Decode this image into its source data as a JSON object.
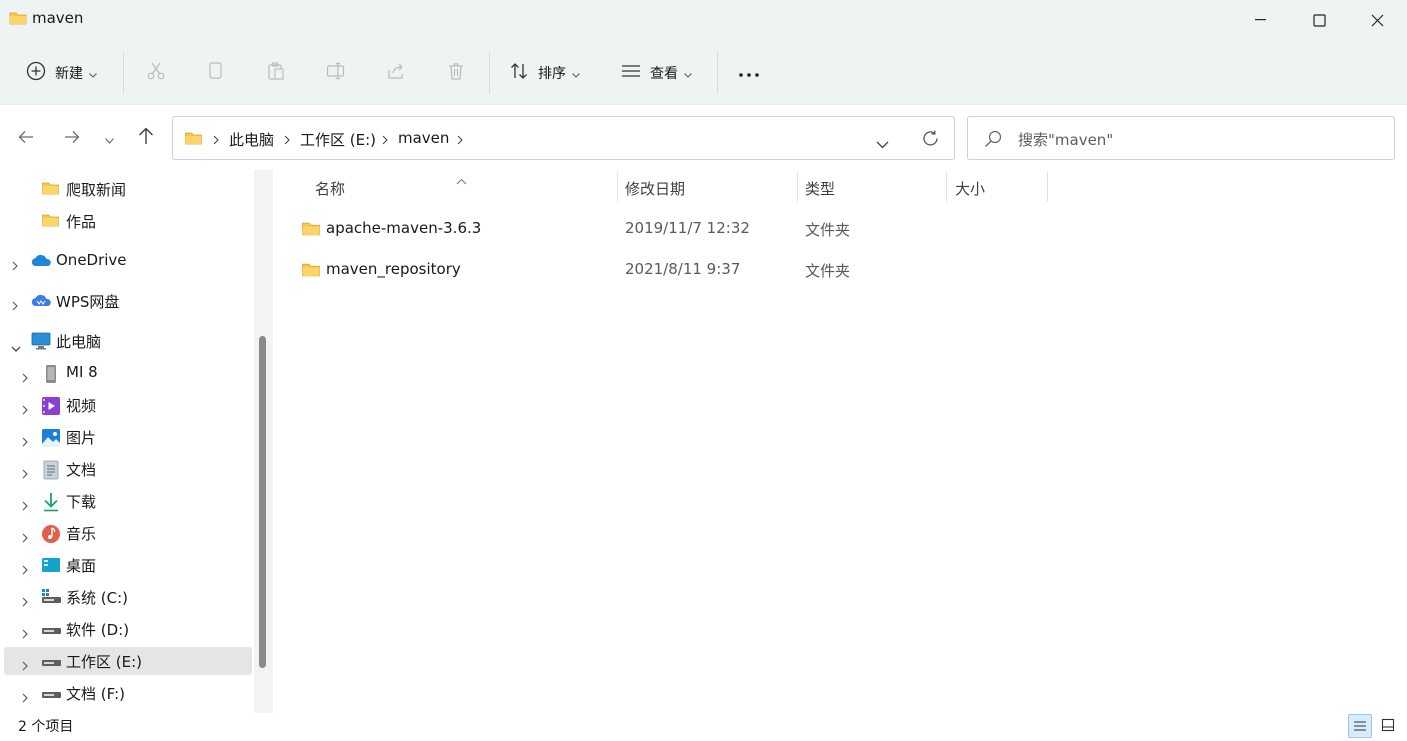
{
  "window": {
    "title": "maven"
  },
  "toolbar": {
    "new_label": "新建",
    "sort_label": "排序",
    "view_label": "查看"
  },
  "address": {
    "crumbs": [
      "此电脑",
      "工作区 (E:)",
      "maven"
    ]
  },
  "search": {
    "placeholder": "搜索\"maven\""
  },
  "sidebar": {
    "items": [
      {
        "label": "爬取新闻",
        "icon": "folder-icon"
      },
      {
        "label": "作品",
        "icon": "folder-icon"
      },
      {
        "label": "OneDrive",
        "icon": "onedrive-cloud-icon"
      },
      {
        "label": "WPS网盘",
        "icon": "wps-cloud-icon"
      },
      {
        "label": "此电脑",
        "icon": "this-pc-icon"
      },
      {
        "label": "MI 8",
        "icon": "phone-icon"
      },
      {
        "label": "视频",
        "icon": "videos-icon"
      },
      {
        "label": "图片",
        "icon": "pictures-icon"
      },
      {
        "label": "文档",
        "icon": "documents-icon"
      },
      {
        "label": "下载",
        "icon": "downloads-icon"
      },
      {
        "label": "音乐",
        "icon": "music-icon"
      },
      {
        "label": "桌面",
        "icon": "desktop-icon"
      },
      {
        "label": "系统 (C:)",
        "icon": "system-drive-icon"
      },
      {
        "label": "软件 (D:)",
        "icon": "drive-icon"
      },
      {
        "label": "工作区 (E:)",
        "icon": "drive-icon"
      },
      {
        "label": "文档 (F:)",
        "icon": "drive-icon"
      }
    ]
  },
  "columns": {
    "name": "名称",
    "date": "修改日期",
    "type": "类型",
    "size": "大小"
  },
  "files": [
    {
      "name": "apache-maven-3.6.3",
      "date": "2019/11/7 12:32",
      "type": "文件夹",
      "size": ""
    },
    {
      "name": "maven_repository",
      "date": "2021/8/11 9:37",
      "type": "文件夹",
      "size": ""
    }
  ],
  "status": {
    "count_text": "2 个项目"
  },
  "colors": {
    "folder": "#f7c64d",
    "chrome": "#eef4f4",
    "selection": "#e5e5e5",
    "accent": "#0067c0"
  }
}
